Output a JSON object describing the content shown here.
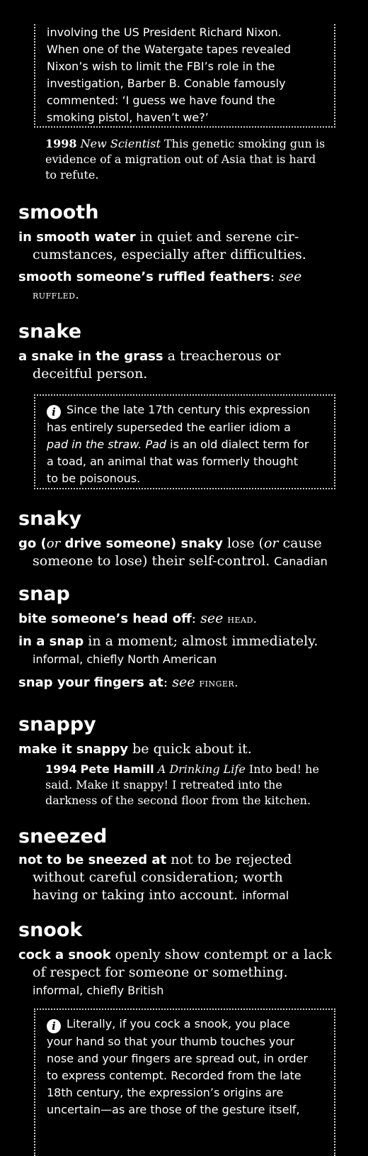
{
  "note_top": {
    "lines": [
      "involving the US President Richard Nixon.",
      "When one of the Watergate tapes revealed",
      "Nixon’s wish to limit the FBI’s role in the",
      "investigation, Barber B. Conable famously",
      "commented: ‘I guess we have found the",
      "smoking pistol, haven’t we?’"
    ]
  },
  "quote_1998": {
    "year": "1998",
    "source": "New Scientist",
    "text_line1": "This genetic smoking gun is",
    "text_line2": "evidence of a migration out of Asia that is hard",
    "text_line3": "to refute."
  },
  "entries": {
    "smooth": {
      "headword": "smooth",
      "s1_phrase": "in smooth water",
      "s1_def_a": "in quiet and serene cir-",
      "s1_def_b": "cumstances, especially after difficulties.",
      "s2_phrase": "smooth someone’s ruffled feathers",
      "s2_colon": ":",
      "s2_see": "see",
      "s2_ref": "ruffled."
    },
    "snake": {
      "headword": "snake",
      "s1_phrase": "a snake in the grass",
      "s1_def_a": "a treacherous or",
      "s1_def_b": "deceitful person.",
      "note_icon": "i",
      "note_l1": "Since the late 17th century this expression",
      "note_l2": "has entirely superseded the earlier idiom a",
      "note_l3_italic": "pad in the straw.",
      "note_l3_italic2": "Pad",
      "note_l3_rest": "is an old dialect term for",
      "note_l4": "a toad, an animal that was formerly thought",
      "note_l5": "to be poisonous."
    },
    "snaky": {
      "headword": "snaky",
      "s1_phrase_a": "go (",
      "s1_or": "or",
      "s1_phrase_b": "drive someone) snaky",
      "s1_def_a": "lose (",
      "s1_def_or": "or",
      "s1_def_b": "cause",
      "s1_def_c": "someone to lose) their self-control.",
      "s1_reg": "Canadian"
    },
    "snap": {
      "headword": "snap",
      "s1_phrase": "bite someone’s head off",
      "s1_colon": ":",
      "s1_see": "see",
      "s1_ref": "head.",
      "s2_phrase": "in a snap",
      "s2_def": "in a moment; almost immediately.",
      "s2_reg": "informal, chiefly North American",
      "s3_phrase": "snap your fingers at",
      "s3_colon": ":",
      "s3_see": "see",
      "s3_ref": "finger."
    },
    "snappy": {
      "headword": "snappy",
      "s1_phrase": "make it snappy",
      "s1_def": "be quick about it.",
      "q_year": "1994",
      "q_author": "Pete Hamill",
      "q_source": "A Drinking Life",
      "q_l1": "Into bed! he",
      "q_l2": "said. Make it snappy! I retreated into the",
      "q_l3": "darkness of the second floor from the kitchen."
    },
    "sneezed": {
      "headword": "sneezed",
      "s1_phrase": "not to be sneezed at",
      "s1_def_a": "not to be rejected",
      "s1_def_b": "without careful consideration; worth",
      "s1_def_c": "having or taking into account.",
      "s1_reg": "informal"
    },
    "snook": {
      "headword": "snook",
      "s1_phrase": "cock a snook",
      "s1_def_a": "openly show contempt or a lack",
      "s1_def_b": "of respect for someone or something.",
      "s1_reg": "informal, chiefly British",
      "note_icon": "i",
      "note_l1": "Literally, if you cock a snook, you place",
      "note_l2": "your hand so that your thumb touches your",
      "note_l3": "nose and your fingers are spread out, in order",
      "note_l4": "to express contempt. Recorded from the late",
      "note_l5": "18th century, the expression’s origins are",
      "note_l6": "uncertain—as are those of the gesture itself,"
    }
  }
}
